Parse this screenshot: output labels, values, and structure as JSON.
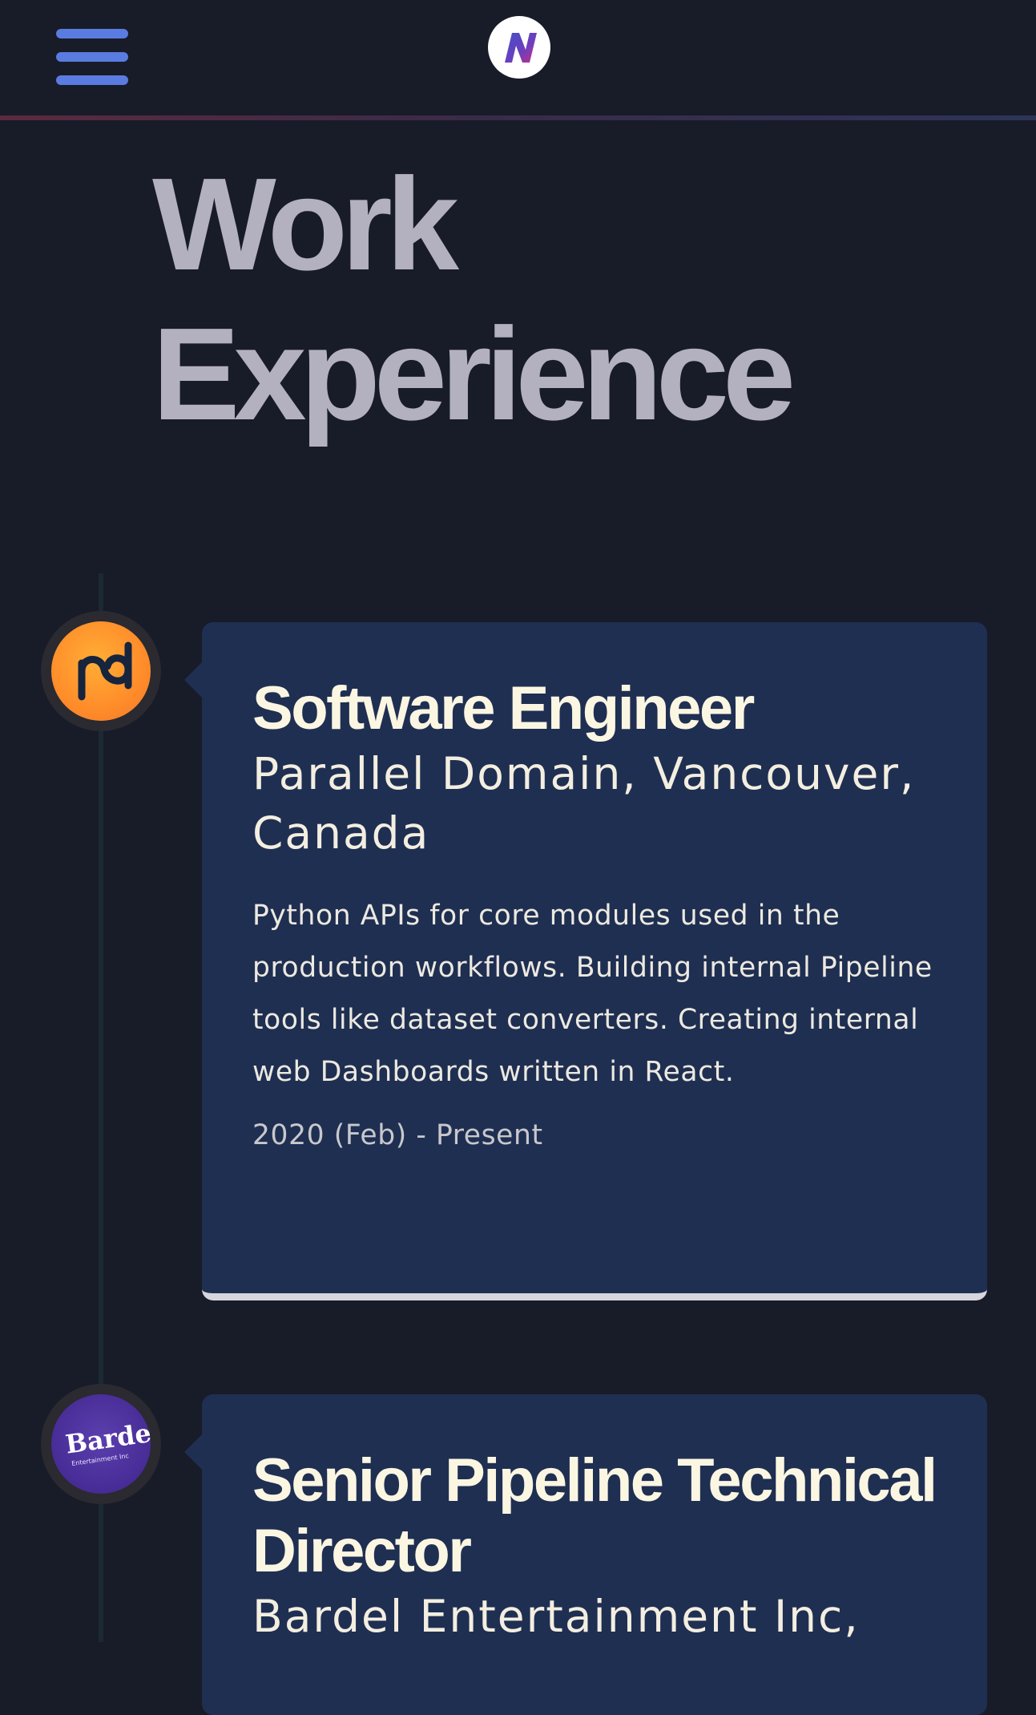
{
  "header": {
    "menu_icon": "hamburger-menu-icon",
    "logo_icon": "n-logo-icon",
    "colors": {
      "background": "#181b28",
      "menu_icon": "#5a7ce0",
      "divider_start": "#5a2a3e",
      "divider_end": "#2c3458"
    }
  },
  "page": {
    "title_line1": "Work",
    "title_line2": "Experience",
    "title_color": "#b3b1c0"
  },
  "timeline": {
    "card_color": "#1f2f52",
    "jobs": [
      {
        "icon": "parallel-domain-logo-icon",
        "icon_color": "#ff9a30",
        "logo_text": "pd",
        "title": "Software Engineer",
        "company": "Parallel Domain, Vancouver, Canada",
        "description": "Python APIs for core modules used in the production workflows. Building internal Pipeline tools like dataset converters. Creating internal web Dashboards written in React.",
        "dates": "2020 (Feb) - Present"
      },
      {
        "icon": "bardel-logo-icon",
        "icon_color": "#4a2e98",
        "logo_text": "Bardel",
        "logo_subtext": "Entertainment Inc",
        "title": "Senior Pipeline Technical Director",
        "company": "Bardel Entertainment Inc,"
      }
    ]
  }
}
